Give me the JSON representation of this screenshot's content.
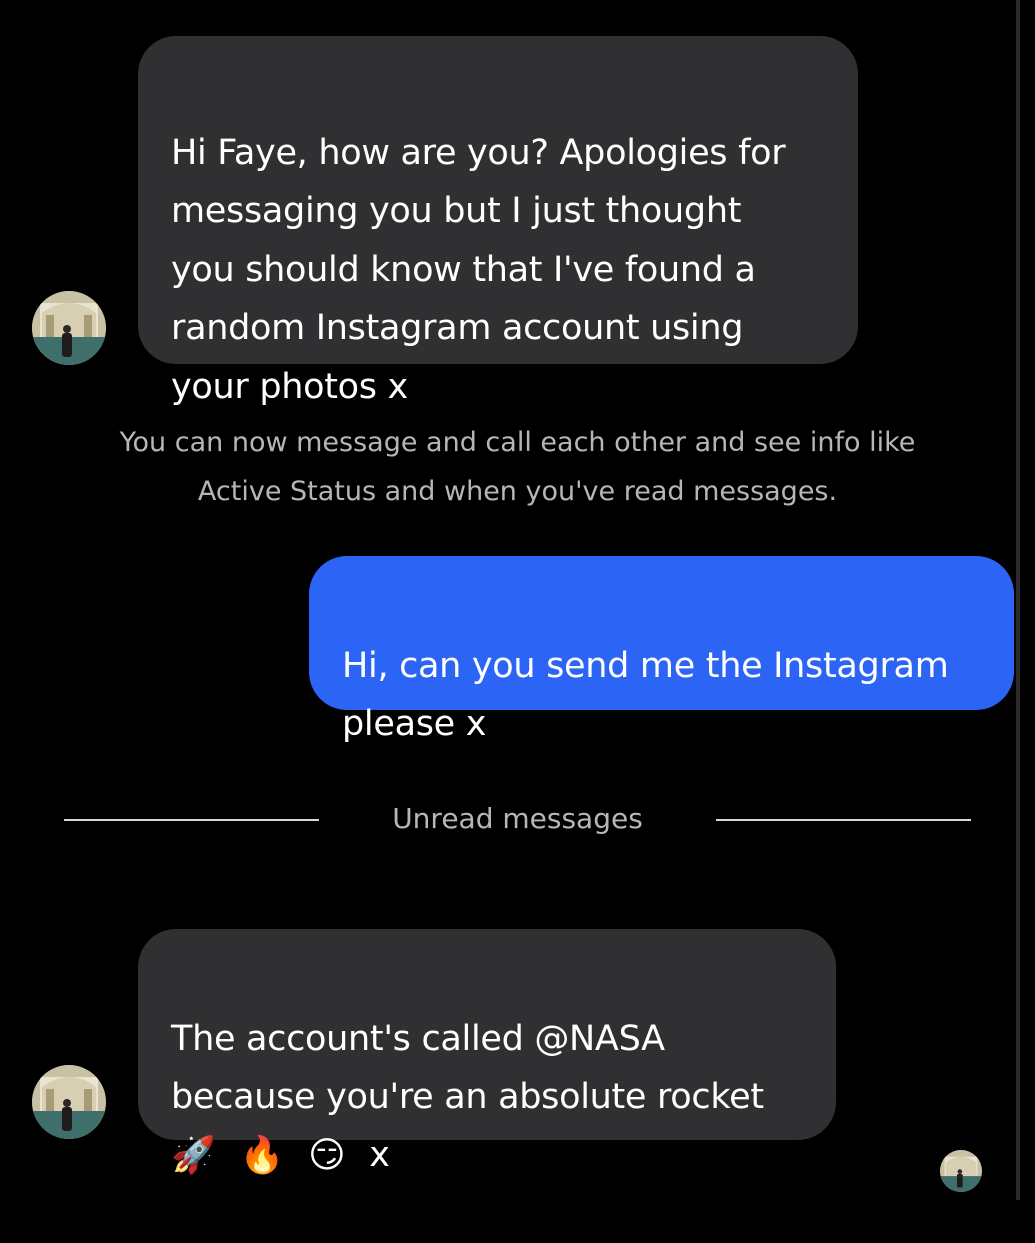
{
  "conversation": {
    "message_1": {
      "text": "Hi Faye, how are you? Apologies for\nmessaging you but I just thought\nyou should know that I've found a\nrandom Instagram account using\nyour photos x"
    },
    "system_note": "You can now message and call each other and see info like\nActive Status and when you've read messages.",
    "message_2": {
      "text": "Hi, can you send me the Instagram\nplease x"
    },
    "unread_divider": {
      "label": "Unread messages"
    },
    "message_3": {
      "text": "The account's called @NASA\nbecause you're an absolute rocket",
      "emojis": [
        "🚀",
        "🔥",
        "😏"
      ],
      "tail": "x"
    }
  },
  "colors": {
    "background": "#000000",
    "received_bubble": "#303032",
    "sent_bubble": "#2c64f6",
    "secondary_text": "#b6b6ba"
  },
  "icons": {
    "avatar": "profile-photo-avatar"
  }
}
